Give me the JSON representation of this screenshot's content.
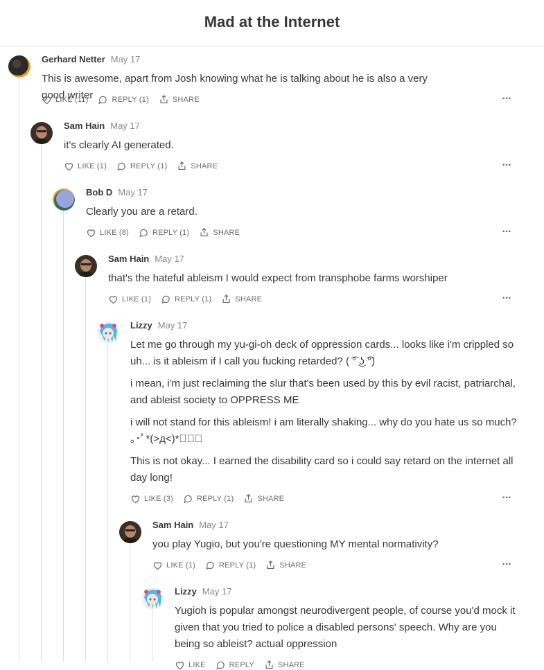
{
  "page": {
    "title": "Mad at the Internet"
  },
  "comments": [
    {
      "author": "Gerhard Netter",
      "date": "May 17",
      "body": [
        "This is awesome, apart from Josh knowing what he is talking about he is also a very good writer"
      ],
      "like": "LIKE (11)",
      "reply": "REPLY (1)",
      "share": "SHARE"
    },
    {
      "author": "Sam Hain",
      "date": "May 17",
      "body": [
        "it's clearly AI generated."
      ],
      "like": "LIKE (1)",
      "reply": "REPLY (1)",
      "share": "SHARE"
    },
    {
      "author": "Bob D",
      "date": "May 17",
      "body": [
        "Clearly you are a retard."
      ],
      "like": "LIKE (8)",
      "reply": "REPLY (1)",
      "share": "SHARE"
    },
    {
      "author": "Sam Hain",
      "date": "May 17",
      "body": [
        "that's the hateful ableism I would expect from transphobe farms worshiper"
      ],
      "like": "LIKE (1)",
      "reply": "REPLY (1)",
      "share": "SHARE"
    },
    {
      "author": "Lizzy",
      "date": "May 17",
      "body": [
        "Let me go through my yu-gi-oh deck of oppression cards... looks like i'm crippled so uh... is it ableism if I call you fucking retarded? ( ͡° ͜ʖ ͡°)",
        "i mean, i'm just reclaiming the slur that's been used by this by evil racist, patriarchal, and ableist society to OPPRESS ME",
        "i will not stand for this ableism! i am literally shaking... why do you hate us so much? ｡･ﾟ*(>д<)*ﾟ･｡",
        "This is not okay... I earned the disability card so i could say retard on the internet all day long!"
      ],
      "like": "LIKE (3)",
      "reply": "REPLY (1)",
      "share": "SHARE"
    },
    {
      "author": "Sam Hain",
      "date": "May 17",
      "body": [
        "you play Yugio, but you're questioning MY mental normativity?"
      ],
      "like": "LIKE (1)",
      "reply": "REPLY (1)",
      "share": "SHARE"
    },
    {
      "author": "Lizzy",
      "date": "May 17",
      "body": [
        "Yugioh is popular amongst neurodivergent people, of course you'd mock it given that you tried to police a disabled persons' speech. Why are you being so ableist? actual oppression"
      ],
      "like": "LIKE",
      "reply": "REPLY",
      "share": "SHARE"
    }
  ]
}
